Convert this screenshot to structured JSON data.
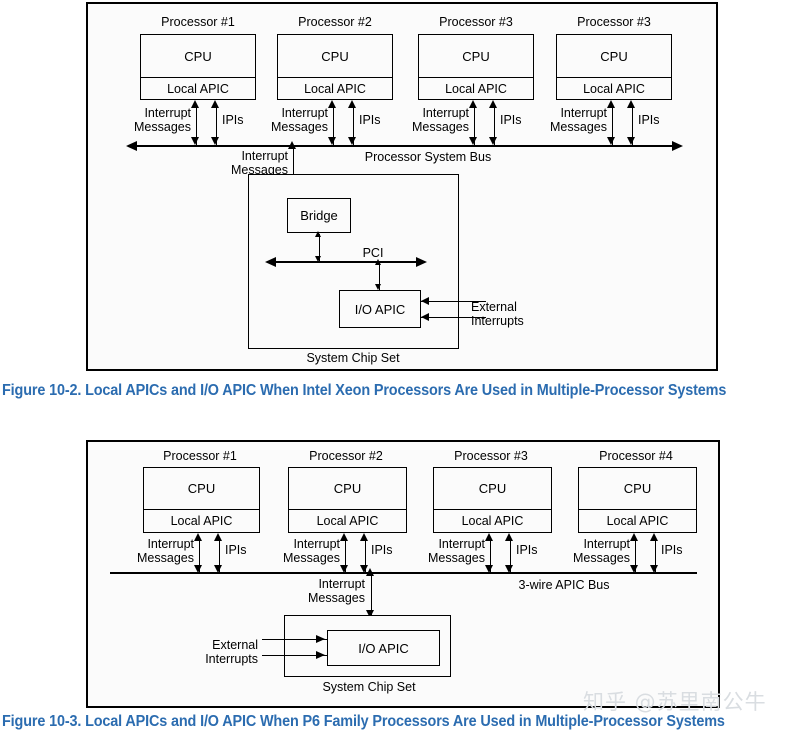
{
  "figures": [
    {
      "id": "figure-10-2",
      "caption": "Figure 10-2.  Local APICs and I/O APIC When Intel Xeon Processors Are Used in Multiple-Processor Systems",
      "processors": [
        {
          "title": "Processor #1",
          "cpu": "CPU",
          "apic": "Local APIC",
          "interrupt": "Interrupt\nMessages",
          "ipi": "IPIs"
        },
        {
          "title": "Processor #2",
          "cpu": "CPU",
          "apic": "Local APIC",
          "interrupt": "Interrupt\nMessages",
          "ipi": "IPIs"
        },
        {
          "title": "Processor #3",
          "cpu": "CPU",
          "apic": "Local APIC",
          "interrupt": "Interrupt\nMessages",
          "ipi": "IPIs"
        },
        {
          "title": "Processor #3",
          "cpu": "CPU",
          "apic": "Local APIC",
          "interrupt": "Interrupt\nMessages",
          "ipi": "IPIs"
        }
      ],
      "bus_label": "Processor System Bus",
      "bridge_interrupt_label": "Interrupt\nMessages",
      "chipset": {
        "bridge": "Bridge",
        "pci_bus": "PCI",
        "io_apic": "I/O APIC",
        "external": "External\nInterrupts",
        "title": "System Chip Set"
      }
    },
    {
      "id": "figure-10-3",
      "caption": "Figure 10-3.  Local APICs and I/O APIC When P6 Family Processors Are Used in Multiple-Processor Systems",
      "processors": [
        {
          "title": "Processor #1",
          "cpu": "CPU",
          "apic": "Local APIC",
          "interrupt": "Interrupt\nMessages",
          "ipi": "IPIs"
        },
        {
          "title": "Processor #2",
          "cpu": "CPU",
          "apic": "Local APIC",
          "interrupt": "Interrupt\nMessages",
          "ipi": "IPIs"
        },
        {
          "title": "Processor #3",
          "cpu": "CPU",
          "apic": "Local APIC",
          "interrupt": "Interrupt\nMessages",
          "ipi": "IPIs"
        },
        {
          "title": "Processor #4",
          "cpu": "CPU",
          "apic": "Local APIC",
          "interrupt": "Interrupt\nMessages",
          "ipi": "IPIs"
        }
      ],
      "bus_label": "3-wire APIC Bus",
      "chipset_interrupt_label": "Interrupt\nMessages",
      "chipset": {
        "io_apic": "I/O APIC",
        "external": "External\nInterrupts",
        "title": "System Chip Set"
      }
    }
  ],
  "watermark": "知乎 @苏里南公牛",
  "colors": {
    "caption": "#2b6cb0",
    "line": "#000000",
    "frame_bg": "#fbfbfb",
    "page_bg": "#ffffff",
    "watermark": "#d9dde1"
  }
}
